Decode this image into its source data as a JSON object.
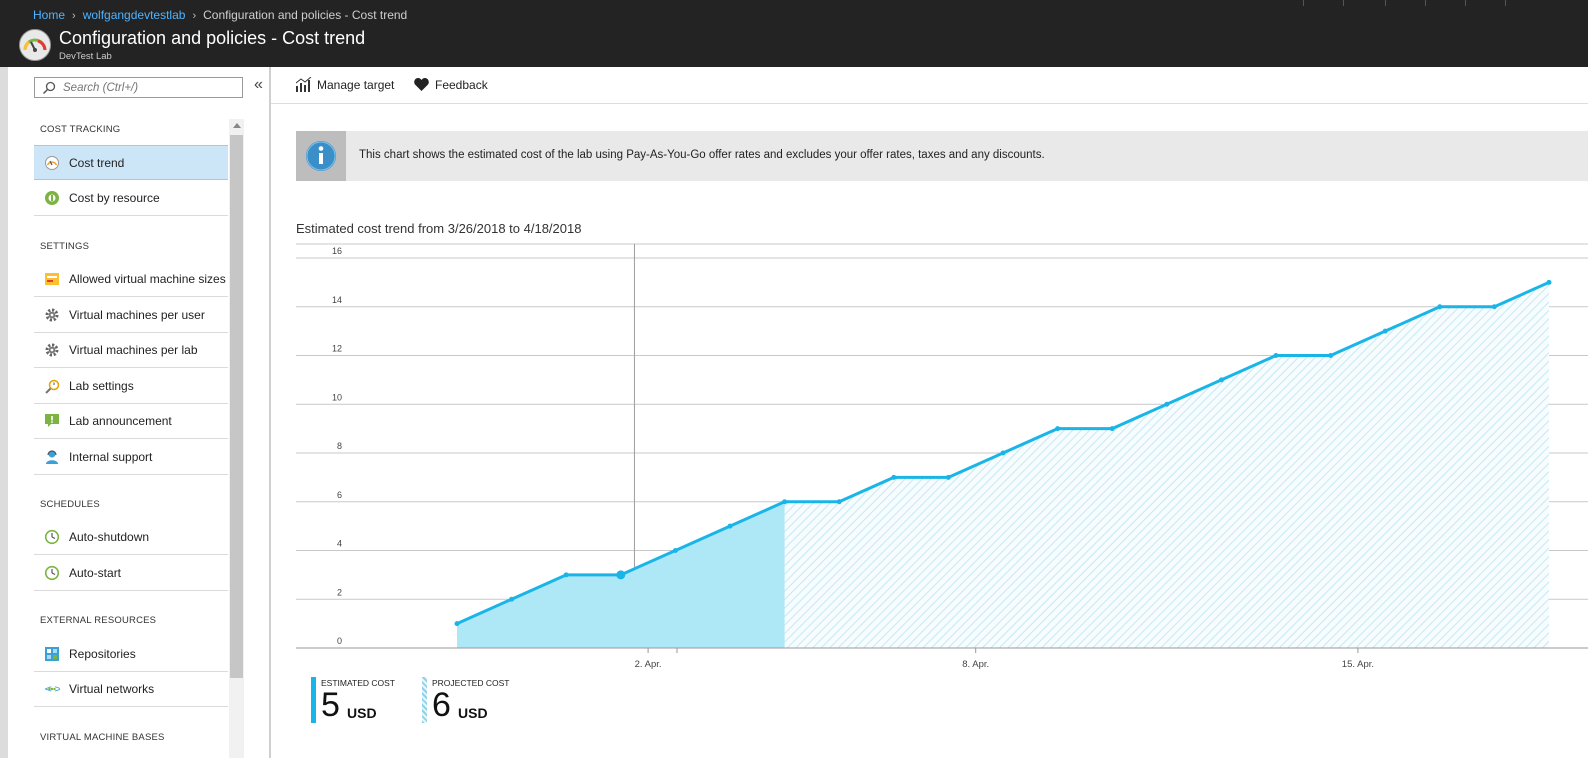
{
  "breadcrumb": {
    "home": "Home",
    "lab": "wolfgangdevtestlab",
    "current": "Configuration and policies - Cost trend"
  },
  "header": {
    "title": "Configuration and policies - Cost trend",
    "subtitle": "DevTest Lab"
  },
  "search": {
    "placeholder": "Search (Ctrl+/)"
  },
  "nav": {
    "collapse": "«",
    "sections": {
      "cost": "COST TRACKING",
      "settings": "SETTINGS",
      "schedules": "SCHEDULES",
      "external": "EXTERNAL RESOURCES",
      "vmbases": "VIRTUAL MACHINE BASES"
    },
    "items": {
      "cost_trend": "Cost trend",
      "cost_by_resource": "Cost by resource",
      "allowed_vm_sizes": "Allowed virtual machine sizes",
      "vms_per_user": "Virtual machines per user",
      "vms_per_lab": "Virtual machines per lab",
      "lab_settings": "Lab settings",
      "lab_announcement": "Lab announcement",
      "internal_support": "Internal support",
      "auto_shutdown": "Auto-shutdown",
      "auto_start": "Auto-start",
      "repositories": "Repositories",
      "virtual_networks": "Virtual networks"
    }
  },
  "toolbar": {
    "manage_target": "Manage target",
    "feedback": "Feedback"
  },
  "info": {
    "text": "This chart shows the estimated cost of the lab using Pay-As-You-Go offer rates and excludes your offer rates, taxes and any discounts."
  },
  "chart_title": "Estimated cost trend from 3/26/2018 to 4/18/2018",
  "legend": {
    "estimated": {
      "label": "ESTIMATED COST",
      "value": "5",
      "unit": "USD"
    },
    "projected": {
      "label": "PROJECTED COST",
      "value": "6",
      "unit": "USD"
    }
  },
  "colors": {
    "line": "#1ab5e8",
    "estimated_fill": "#aee7f6",
    "projected_hatch": "#bfe6f1",
    "topbar": "#232323",
    "selected": "#cde6f7"
  },
  "chart_data": {
    "type": "area",
    "x": [
      "3/26/2018",
      "3/27/2018",
      "3/28/2018",
      "3/29/2018",
      "3/30/2018",
      "3/31/2018",
      "4/1/2018",
      "4/2/2018",
      "4/3/2018",
      "4/4/2018",
      "4/5/2018",
      "4/6/2018",
      "4/7/2018",
      "4/8/2018",
      "4/9/2018",
      "4/10/2018",
      "4/11/2018",
      "4/12/2018",
      "4/13/2018",
      "4/14/2018",
      "4/15/2018",
      "4/16/2018",
      "4/17/2018",
      "4/18/2018"
    ],
    "y": [
      0,
      0,
      0,
      1,
      2,
      3,
      3,
      4,
      5,
      6,
      6,
      7,
      7,
      8,
      9,
      9,
      10,
      11,
      12,
      12,
      13,
      14,
      14,
      15
    ],
    "estimated_until": "4/4/2018",
    "highlight": "4/1/2018",
    "xticks": [
      {
        "label": "2. Apr.",
        "date": "4/2/2018"
      },
      {
        "label": "8. Apr.",
        "date": "4/8/2018"
      },
      {
        "label": "15. Apr.",
        "date": "4/15/2018"
      }
    ],
    "yticks": [
      0,
      2,
      4,
      6,
      8,
      10,
      12,
      14,
      16
    ],
    "ylim": [
      0,
      16
    ],
    "grid": true,
    "series": [
      {
        "name": "ESTIMATED COST"
      },
      {
        "name": "PROJECTED COST"
      }
    ]
  }
}
